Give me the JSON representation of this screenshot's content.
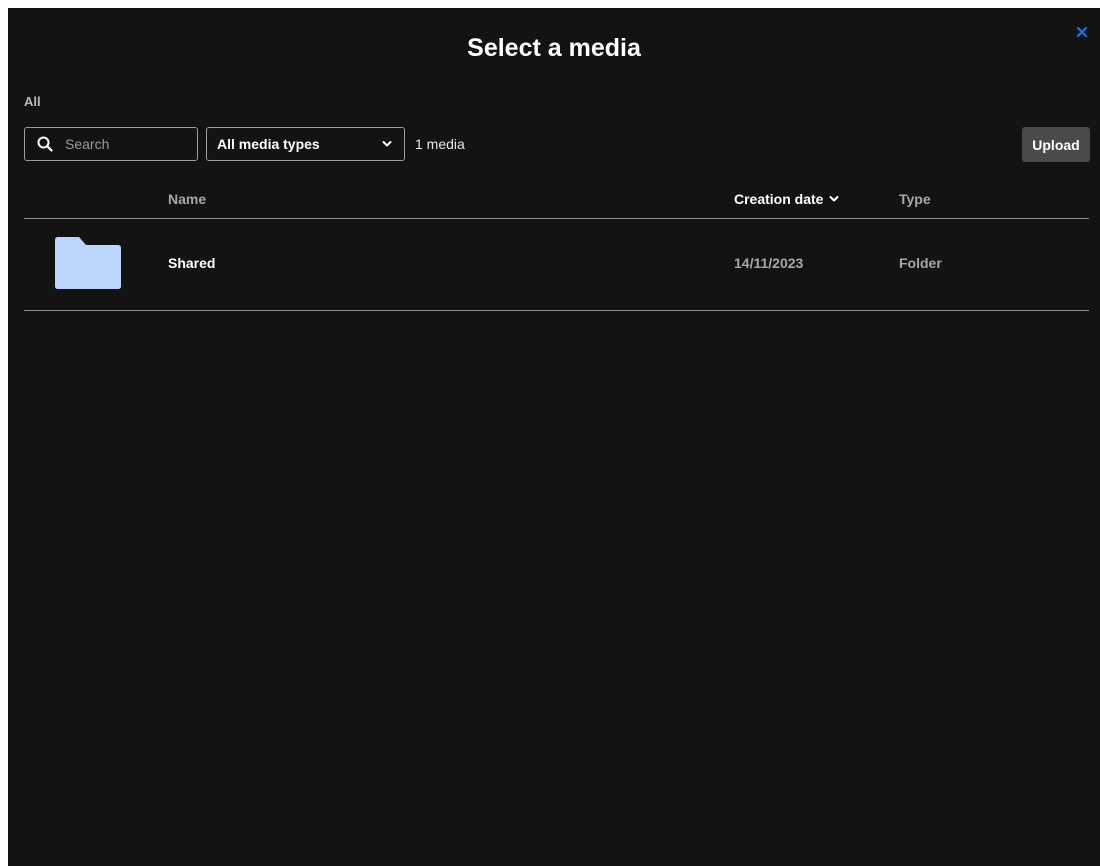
{
  "modal": {
    "title": "Select a media",
    "close_icon": "close-icon",
    "accent_color": "#1a73e8"
  },
  "breadcrumb": {
    "label": "All"
  },
  "toolbar": {
    "search": {
      "placeholder": "Search",
      "value": "",
      "icon": "search-icon"
    },
    "type_filter": {
      "selected": "All media types",
      "icon": "chevron-down-icon"
    },
    "count_label": "1 media",
    "upload_label": "Upload"
  },
  "table": {
    "columns": {
      "name": "Name",
      "creation_date": "Creation date",
      "type": "Type"
    },
    "sorted_by": "creation_date",
    "rows": [
      {
        "icon": "folder-icon",
        "icon_color": "#bcd5fb",
        "name": "Shared",
        "creation_date": "14/11/2023",
        "type": "Folder"
      }
    ]
  }
}
